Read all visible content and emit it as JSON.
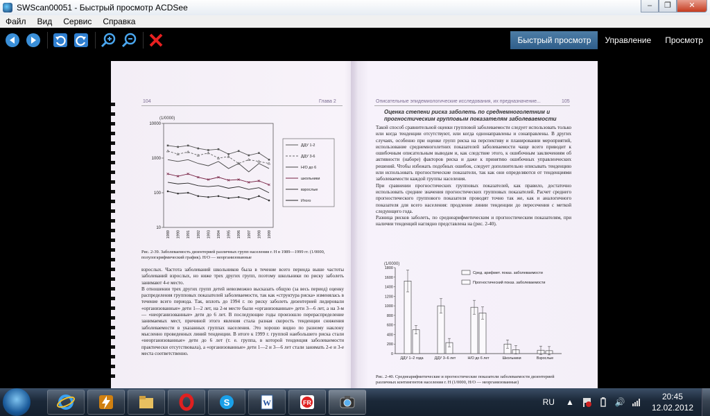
{
  "window": {
    "title": "SWScan00051 - Быстрый просмотр ACDSee"
  },
  "menu": [
    "Файл",
    "Вид",
    "Сервис",
    "Справка"
  ],
  "modes": [
    "Быстрый просмотр",
    "Управление",
    "Просмотр"
  ],
  "scan": {
    "left_header": {
      "page": "104",
      "chapter": "Глава 2"
    },
    "right_header": {
      "title": "Описательные эпидемиологические исследования, их предназначение...",
      "page": "105"
    },
    "chart1": {
      "unit": "(1/0000)",
      "yticks": [
        "10000",
        "1000",
        "100",
        "10"
      ],
      "xticks": [
        "1989",
        "1990",
        "1991",
        "1992",
        "1993",
        "1994",
        "1995",
        "1996",
        "1997",
        "1998",
        "1999"
      ],
      "legend": [
        "ДДУ 1-2",
        "ДДУ 3-6",
        "Н/О до 6",
        "школьники",
        "взрослые",
        "Итого"
      ]
    },
    "caption1": "Рис. 2-39. Заболеваемость дизентерией различных групп населения г. Н в 1989—1999 гг. (1/0000, полулогарифмический график). Н/О — неорганизованные",
    "left_text": "взрослых. Частота заболеваний школьников была в течение всего периода выше частоты заболеваний взрослых, но ниже трех других групп, поэтому школьники по риску заболеть занимают 4-е место.\nВ отношении трех других групп детей невозможно высказать общую (за весь период) оценку распределения групповых показателей заболеваемости, так как «структура риска» изменялась в течение всего периода. Так, вплоть до 1994 г. по риску заболеть дизентерией лидировали «организованные» дети 1—2 лет, на 2-м месте были «организованные» дети 3—6 лет, а на 3-м — «неорганизованные» дети до 6 лет. В последующие годы произошло перераспределение занимаемых мест, причиной этого явления стала разная скорость тенденции снижения заболеваемости в указанных группах населения. Это хорошо видно по разному наклону мысленно проведенных линий тенденции. В итоге к 1999 г. группой наибольшего риска стали «неорганизованные» дети до 6 лет (т. е. группа, в которой тенденция заболеваемости практически отсутствовала), а «организованные» дети 1—2 и 3—6 лет стали занимать 2-е и 3-е места соответственно.",
    "section_title": "Оценка степени риска заболеть по среднемноголетним и прогностическим групповым показателям заболеваемости",
    "right_text": "Такой способ сравнительной оценки групповой заболеваемости следует использовать только или когда тенденции отсутствуют, или когда однонаправлены и сонаправлены. В других случаях, особенно при оценке групп риска на перспективу и планировании мероприятий, использование среднемноголетних показателей заболеваемости чаще всего приводит к ошибочным описательным выводам и, как следствие этого, к ошибочным заключениям об активности (наборе) факторов риска и даже к принятию ошибочных управленческих решений. Чтобы избежать подобных ошибок, следует дополнительно описывать тенденцию или использовать прогностические показатели, так как они определяются от тенденциями заболеваемости каждой группы населения.\nПри сравнении прогностических групповых показателей, как правило, достаточно использовать средние значения прогностических групповых показателей. Расчет среднего прогностического группового показателя проводят точно так же, как и аналогичного показателя для всего населения: продление линии тенденции до пересечения с меткой следующего года.\nРазница рисков заболеть, по среднеарифметическим и прогностическим показателям, при наличии тенденций наглядно представлена на (рис. 2-40).",
    "chart2": {
      "unit": "(1/0000)",
      "yticks": [
        "1800",
        "1600",
        "1400",
        "1200",
        "1000",
        "800",
        "600",
        "400",
        "200",
        "0"
      ],
      "legend": [
        "Сред. арифмет. показ. заболеваемости",
        "Прогностический показ. заболеваемости"
      ],
      "categories": [
        "ДДУ 1–2 года",
        "ДДУ 3–6 лет",
        "Н/О до 6 лет",
        "Школьники",
        "Взрослые"
      ]
    },
    "caption2": "Рис. 2-40. Среднеарифметические и прогностические показатели заболеваемости дизентерией различных контингентов населения г. Н (1/0000, Н/О — неорганизованные)"
  },
  "chart_data": [
    {
      "type": "line",
      "ylabel": "(1/0000)",
      "yscale": "log",
      "ylim": [
        10,
        10000
      ],
      "x": [
        "1989",
        "1990",
        "1991",
        "1992",
        "1993",
        "1994",
        "1995",
        "1996",
        "1997",
        "1998",
        "1999"
      ],
      "series": [
        {
          "name": "ДДУ 1-2",
          "values": [
            2300,
            2100,
            2300,
            1900,
            1700,
            1800,
            1300,
            1600,
            1200,
            1400,
            900
          ]
        },
        {
          "name": "ДДУ 3-6",
          "values": [
            1600,
            1300,
            1500,
            1200,
            1400,
            1000,
            1100,
            700,
            900,
            800,
            700
          ]
        },
        {
          "name": "Н/О до 6",
          "values": [
            900,
            800,
            900,
            700,
            600,
            800,
            500,
            700,
            400,
            700,
            500
          ]
        },
        {
          "name": "школьники",
          "values": [
            350,
            300,
            350,
            280,
            240,
            280,
            230,
            240,
            200,
            220,
            170
          ]
        },
        {
          "name": "взрослые",
          "values": [
            110,
            95,
            100,
            80,
            75,
            80,
            70,
            75,
            65,
            80,
            60
          ]
        },
        {
          "name": "Итого",
          "values": [
            200,
            180,
            190,
            160,
            150,
            160,
            135,
            150,
            125,
            140,
            100
          ]
        }
      ]
    },
    {
      "type": "bar",
      "ylabel": "(1/0000)",
      "ylim": [
        0,
        1800
      ],
      "categories": [
        "ДДУ 1–2 года",
        "ДДУ 3–6 лет",
        "Н/О до 6 лет",
        "Школьники",
        "Взрослые"
      ],
      "series": [
        {
          "name": "Сред. арифмет. показ. заболеваемости",
          "values": [
            1520,
            1000,
            970,
            200,
            70
          ]
        },
        {
          "name": "Прогностический показ. заболеваемости",
          "values": [
            500,
            230,
            850,
            80,
            60
          ]
        }
      ]
    }
  ],
  "taskbar": {
    "lang": "RU",
    "time": "20:45",
    "date": "12.02.2012"
  }
}
